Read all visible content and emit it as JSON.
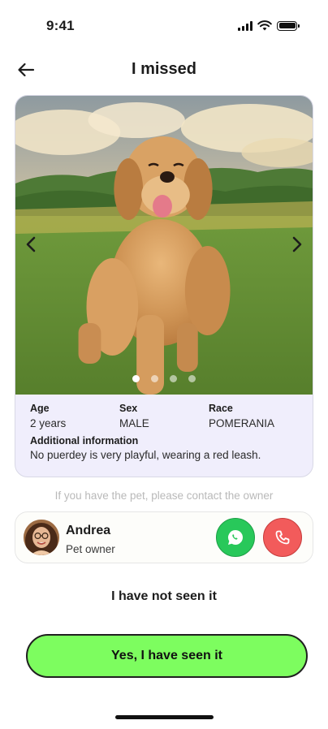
{
  "status_bar": {
    "time": "9:41",
    "icons": [
      "signal-icon",
      "wifi-icon",
      "battery-icon"
    ]
  },
  "header": {
    "title": "I missed",
    "back_icon": "arrow-left-icon"
  },
  "pet": {
    "photo_icons": {
      "prev": "chevron-left-icon",
      "next": "chevron-right-icon"
    },
    "carousel": {
      "total": 4,
      "active": 1
    },
    "details": [
      {
        "label": "Age",
        "value": "2 years"
      },
      {
        "label": "Sex",
        "value": "MALE"
      },
      {
        "label": "Race",
        "value": "POMERANIA"
      }
    ],
    "additional_label": "Additional information",
    "additional_value": "No puerdey is very playful, wearing a red leash."
  },
  "contact_hint": "If you have the pet, please contact the owner",
  "owner": {
    "name": "Andrea",
    "role": "Pet owner",
    "whatsapp_icon": "whatsapp-icon",
    "call_icon": "phone-icon"
  },
  "actions": {
    "not_seen_label": "I have not seen it",
    "seen_label": "Yes, I have seen it"
  },
  "colors": {
    "primary_action": "#7dfd5f",
    "whatsapp": "#28c85a",
    "call": "#f25b5b",
    "info_panel": "#f0eefc",
    "hint_text": "#b9b9b9"
  }
}
